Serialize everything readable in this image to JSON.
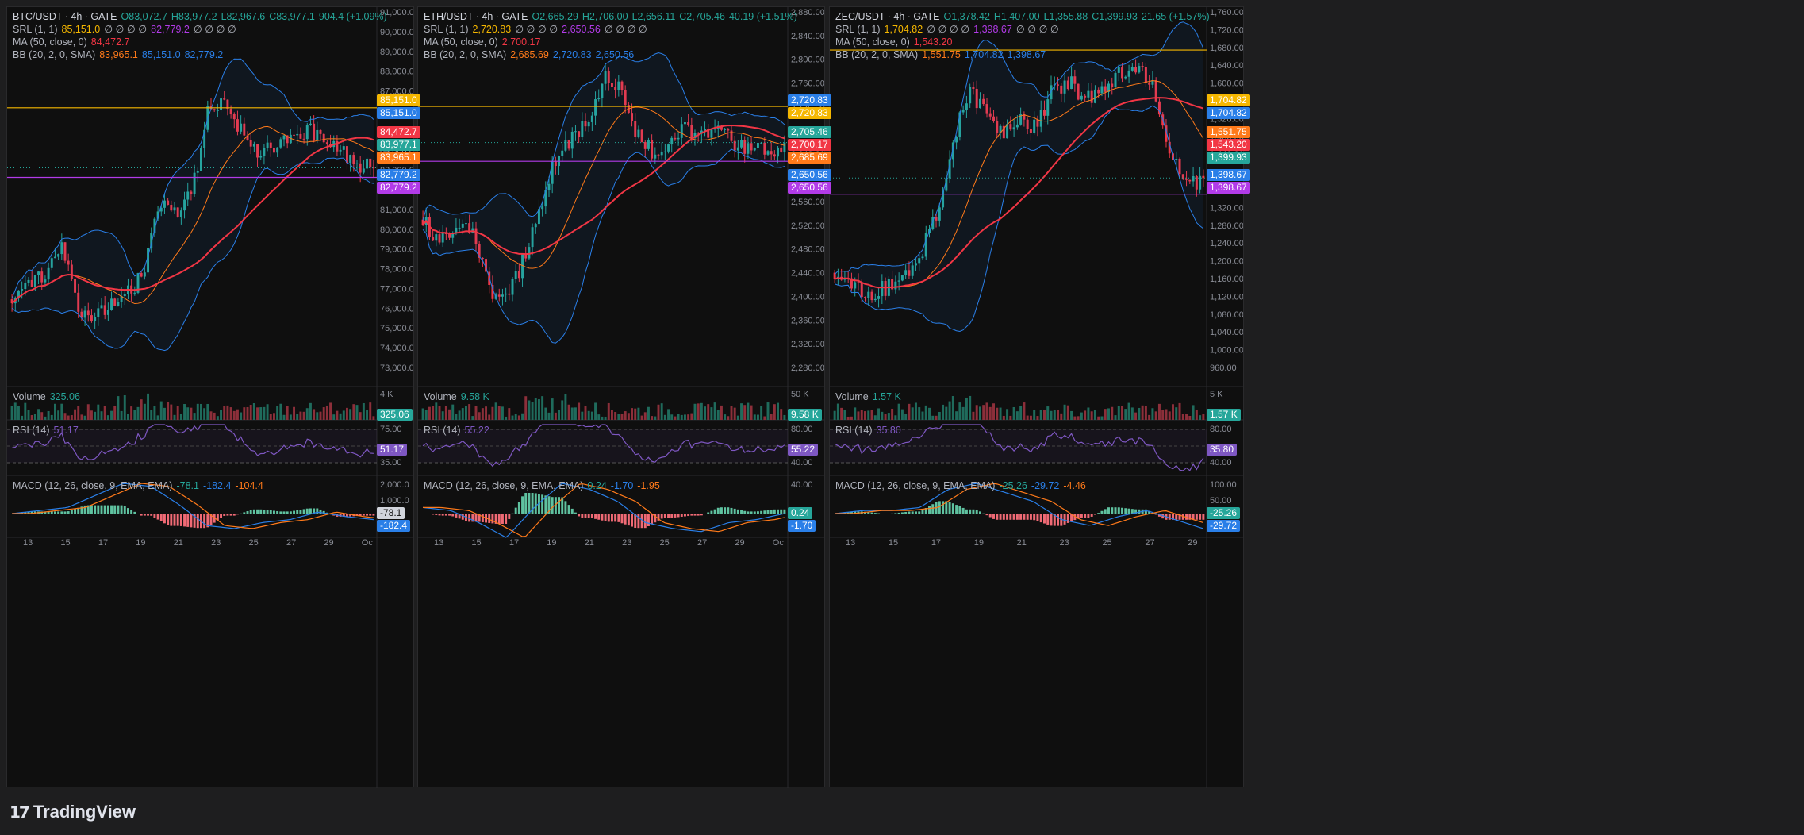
{
  "footer": {
    "brand": "TradingView",
    "logo_icon": "tradingview-logo-icon"
  },
  "panels": [
    {
      "id": "btc",
      "symbol": "BTC/USDT · 4h · GATE",
      "ohlc": {
        "o": "O83,072.7",
        "h": "H83,977.2",
        "l": "L82,967.6",
        "c": "C83,977.1",
        "chg": "904.4 (+1.09%)"
      },
      "srl": {
        "label": "SRL (1, 1)",
        "v1": "85,151.0",
        "dots": "∅ ∅ ∅ ∅",
        "v2": "82,779.2",
        "dots2": "∅ ∅ ∅ ∅"
      },
      "ma": {
        "label": "MA (50, close, 0)",
        "v": "84,472.7"
      },
      "bb": {
        "label": "BB (20, 2, 0, SMA)",
        "v1": "83,965.1",
        "v2": "85,151.0",
        "v3": "82,779.2"
      },
      "volume": {
        "label": "Volume",
        "v": "325.06",
        "axis": "4 K"
      },
      "rsi": {
        "label": "RSI (14)",
        "v": "51.17",
        "axis_hi": "75.00",
        "axis_lo": "35.00"
      },
      "macd": {
        "label": "MACD (12, 26, close, 9, EMA, EMA)",
        "v1": "-78.1",
        "v2": "-182.4",
        "v3": "-104.4",
        "axis_hi": "2,000.0",
        "axis_lo": "1,000.0"
      },
      "price_axis": [
        "91,000.0",
        "90,000.0",
        "89,000.0",
        "88,000.0",
        "87,000.0",
        "86,000.0",
        "85,000.0",
        "84,000.0",
        "83,000.0",
        "82,000.0",
        "81,000.0",
        "80,000.0",
        "79,000.0",
        "78,000.0",
        "77,000.0",
        "76,000.0",
        "75,000.0",
        "74,000.0",
        "73,000.0"
      ],
      "price_tags": [
        {
          "text": "85,151.0",
          "color": "#f5b700"
        },
        {
          "text": "85,151.0",
          "color": "#2a7fe8"
        },
        {
          "text": "84,472.7",
          "color": "#f23645"
        },
        {
          "text": "83,977.1",
          "color": "#26a69a"
        },
        {
          "text": "83,965.1",
          "color": "#ff7a1a"
        },
        {
          "text": "82,779.2",
          "color": "#2a7fe8"
        },
        {
          "text": "82,779.2",
          "color": "#b23be8"
        }
      ],
      "x_axis": [
        "13",
        "15",
        "17",
        "19",
        "21",
        "23",
        "25",
        "27",
        "29",
        "Oc"
      ]
    },
    {
      "id": "eth",
      "symbol": "ETH/USDT · 4h · GATE",
      "ohlc": {
        "o": "O2,665.29",
        "h": "H2,706.00",
        "l": "L2,656.11",
        "c": "C2,705.46",
        "chg": "40.19 (+1.51%)"
      },
      "srl": {
        "label": "SRL (1, 1)",
        "v1": "2,720.83",
        "dots": "∅ ∅ ∅ ∅",
        "v2": "2,650.56",
        "dots2": "∅ ∅ ∅ ∅"
      },
      "ma": {
        "label": "MA (50, close, 0)",
        "v": "2,700.17"
      },
      "bb": {
        "label": "BB (20, 2, 0, SMA)",
        "v1": "2,685.69",
        "v2": "2,720.83",
        "v3": "2,650.56"
      },
      "volume": {
        "label": "Volume",
        "v": "9.58 K",
        "axis": "50 K"
      },
      "rsi": {
        "label": "RSI (14)",
        "v": "55.22",
        "axis_hi": "80.00",
        "axis_lo": "40.00"
      },
      "macd": {
        "label": "MACD (12, 26, close, 9, EMA, EMA)",
        "v1": "0.24",
        "v2": "-1.70",
        "v3": "-1.95",
        "axis_hi": "40.00",
        "axis_lo": ""
      },
      "price_axis": [
        "2,880.00",
        "2,840.00",
        "2,800.00",
        "2,760.00",
        "2,720.00",
        "2,680.00",
        "2,640.00",
        "2,600.00",
        "2,560.00",
        "2,520.00",
        "2,480.00",
        "2,440.00",
        "2,400.00",
        "2,360.00",
        "2,320.00",
        "2,280.00"
      ],
      "price_tags": [
        {
          "text": "2,720.83",
          "color": "#2a7fe8"
        },
        {
          "text": "2,720.83",
          "color": "#f5b700"
        },
        {
          "text": "2,705.46",
          "color": "#26a69a"
        },
        {
          "text": "2,700.17",
          "color": "#f23645"
        },
        {
          "text": "2,685.69",
          "color": "#ff7a1a"
        },
        {
          "text": "2,650.56",
          "color": "#2a7fe8"
        },
        {
          "text": "2,650.56",
          "color": "#b23be8"
        }
      ],
      "x_axis": [
        "13",
        "15",
        "17",
        "19",
        "21",
        "23",
        "25",
        "27",
        "29",
        "Oc"
      ]
    },
    {
      "id": "zec",
      "symbol": "ZEC/USDT · 4h · GATE",
      "ohlc": {
        "o": "O1,378.42",
        "h": "H1,407.00",
        "l": "L1,355.88",
        "c": "C1,399.93",
        "chg": "21.65 (+1.57%)"
      },
      "srl": {
        "label": "SRL (1, 1)",
        "v1": "1,704.82",
        "dots": "∅ ∅ ∅ ∅",
        "v2": "1,398.67",
        "dots2": "∅ ∅ ∅ ∅"
      },
      "ma": {
        "label": "MA (50, close, 0)",
        "v": "1,543.20"
      },
      "bb": {
        "label": "BB (20, 2, 0, SMA)",
        "v1": "1,551.75",
        "v2": "1,704.82",
        "v3": "1,398.67"
      },
      "volume": {
        "label": "Volume",
        "v": "1.57 K",
        "axis": "5 K"
      },
      "rsi": {
        "label": "RSI (14)",
        "v": "35.80",
        "axis_hi": "80.00",
        "axis_lo": "40.00"
      },
      "macd": {
        "label": "MACD (12, 26, close, 9, EMA, EMA)",
        "v1": "-25.26",
        "v2": "-29.72",
        "v3": "-4.46",
        "axis_hi": "100.00",
        "axis_lo": "50.00"
      },
      "price_axis": [
        "1,760.00",
        "1,720.00",
        "1,680.00",
        "1,640.00",
        "1,600.00",
        "1,560.00",
        "1,520.00",
        "1,480.00",
        "1,440.00",
        "1,400.00",
        "1,360.00",
        "1,320.00",
        "1,280.00",
        "1,240.00",
        "1,200.00",
        "1,160.00",
        "1,120.00",
        "1,080.00",
        "1,040.00",
        "1,000.00",
        "960.00"
      ],
      "price_tags": [
        {
          "text": "1,704.82",
          "color": "#f5b700"
        },
        {
          "text": "1,704.82",
          "color": "#2a7fe8"
        },
        {
          "text": "1,551.75",
          "color": "#ff7a1a"
        },
        {
          "text": "1,543.20",
          "color": "#f23645"
        },
        {
          "text": "1,399.93",
          "color": "#26a69a"
        },
        {
          "text": "1,398.67",
          "color": "#2a7fe8"
        },
        {
          "text": "1,398.67",
          "color": "#b23be8"
        }
      ],
      "x_axis": [
        "13",
        "15",
        "17",
        "19",
        "21",
        "23",
        "25",
        "27",
        "29"
      ]
    }
  ],
  "colors": {
    "up": "#26a69a",
    "down": "#f23645",
    "ma": "#f23645",
    "bb_mid": "#ff7a1a",
    "bb_band": "#2a7fe8",
    "srl_hi": "#f5b700",
    "srl_lo": "#b23be8",
    "rsi": "#7e57c2"
  }
}
